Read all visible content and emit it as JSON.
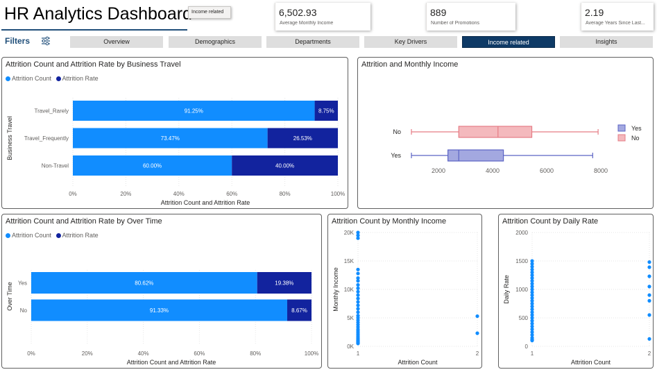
{
  "header": {
    "title": "HR Analytics Dashboard",
    "tooltip_tag": "Income related",
    "filters_label": "Filters",
    "kpis": [
      {
        "value": "6,502.93",
        "label": "Average Monthly Income"
      },
      {
        "value": "889",
        "label": "Number of Promotions"
      },
      {
        "value": "2.19",
        "label": "Average Years Since Last..."
      }
    ]
  },
  "tabs": [
    "Overview",
    "Demographics",
    "Departments",
    "Key Drivers",
    "Income related",
    "Insights"
  ],
  "active_tab": "Income related",
  "colors": {
    "count": "#118dff",
    "rate": "#12239e",
    "yes_box": "#5b63c4",
    "no_box": "#e57c85",
    "accent": "#1f4e79"
  },
  "legend_labels": {
    "count": "Attrition Count",
    "rate": "Attrition Rate"
  },
  "chart_data": [
    {
      "type": "bar",
      "stacked_percent": true,
      "orientation": "horizontal",
      "title": "Attrition Count and Attrition Rate by Business Travel",
      "ylabel": "Business Travel",
      "xlabel": "Attrition Count and Attrition Rate",
      "categories": [
        "Travel_Rarely",
        "Travel_Frequently",
        "Non-Travel"
      ],
      "series": [
        {
          "name": "Attrition Count",
          "values": [
            91.25,
            73.47,
            60.0
          ],
          "labels": [
            "91.25%",
            "73.47%",
            "60.00%"
          ]
        },
        {
          "name": "Attrition Rate",
          "values": [
            8.75,
            26.53,
            40.0
          ],
          "labels": [
            "8.75%",
            "26.53%",
            "40.00%"
          ]
        }
      ],
      "xticks": [
        "0%",
        "20%",
        "40%",
        "60%",
        "80%",
        "100%"
      ],
      "xlim": [
        0,
        100
      ],
      "legend": "top-left"
    },
    {
      "type": "box",
      "title": "Attrition and Monthly Income",
      "categories": [
        "No",
        "Yes"
      ],
      "series": [
        {
          "name": "No",
          "min": 1000,
          "q1": 2750,
          "median": 4200,
          "q3": 5450,
          "max": 7900
        },
        {
          "name": "Yes",
          "min": 1000,
          "q1": 2350,
          "median": 2750,
          "q3": 4400,
          "max": 7700
        }
      ],
      "xticks": [
        "2000",
        "4000",
        "6000",
        "8000"
      ],
      "xlim": [
        1000,
        9000
      ],
      "legend_items": [
        "Yes",
        "No"
      ],
      "legend": "right"
    },
    {
      "type": "bar",
      "stacked_percent": true,
      "orientation": "horizontal",
      "title": "Attrition Count and Attrition Rate by Over Time",
      "ylabel": "Over Time",
      "xlabel": "Attrition Count and Attrition Rate",
      "categories": [
        "Yes",
        "No"
      ],
      "series": [
        {
          "name": "Attrition Count",
          "values": [
            80.62,
            91.33
          ],
          "labels": [
            "80.62%",
            "91.33%"
          ]
        },
        {
          "name": "Attrition Rate",
          "values": [
            19.38,
            8.67
          ],
          "labels": [
            "19.38%",
            "8.67%"
          ]
        }
      ],
      "xticks": [
        "0%",
        "20%",
        "40%",
        "60%",
        "80%",
        "100%"
      ],
      "xlim": [
        0,
        100
      ],
      "legend": "top-left"
    },
    {
      "type": "scatter",
      "title": "Attrition Count by Monthly Income",
      "xlabel": "Attrition Count",
      "ylabel": "Monthly Income",
      "x": [
        1,
        1,
        1,
        1,
        1,
        1,
        1,
        1,
        1,
        1,
        1,
        1,
        1,
        1,
        1,
        1,
        1,
        1,
        1,
        1,
        1,
        1,
        1,
        1,
        1,
        1,
        1,
        1,
        1,
        1,
        1,
        1,
        1,
        1,
        1,
        1,
        2,
        2
      ],
      "y": [
        19000,
        19500,
        20000,
        13500,
        12800,
        12000,
        11500,
        10800,
        10200,
        9600,
        9000,
        8400,
        7800,
        7200,
        6600,
        6000,
        5400,
        5000,
        4600,
        4200,
        3800,
        3400,
        3000,
        2700,
        2400,
        2100,
        1800,
        1500,
        1300,
        1100,
        1000,
        900,
        800,
        700,
        600,
        500,
        5300,
        2300
      ],
      "yticks": [
        "0K",
        "5K",
        "10K",
        "15K",
        "20K"
      ],
      "xticks": [
        "1",
        "2"
      ],
      "ylim": [
        0,
        20000
      ],
      "xlim": [
        1,
        2
      ]
    },
    {
      "type": "scatter",
      "title": "Attrition Count by Daily Rate",
      "xlabel": "Attrition Count",
      "ylabel": "Daily Rate",
      "x": [
        1,
        1,
        1,
        1,
        1,
        1,
        1,
        1,
        1,
        1,
        1,
        1,
        1,
        1,
        1,
        1,
        1,
        1,
        1,
        1,
        1,
        1,
        1,
        1,
        1,
        1,
        1,
        1,
        1,
        1,
        1,
        2,
        2,
        2,
        2,
        2,
        2,
        2,
        2
      ],
      "y": [
        1500,
        1450,
        1400,
        1350,
        1300,
        1250,
        1200,
        1150,
        1100,
        1050,
        1000,
        950,
        900,
        850,
        800,
        750,
        700,
        650,
        600,
        550,
        500,
        450,
        400,
        350,
        300,
        250,
        200,
        150,
        120,
        110,
        102,
        1480,
        1390,
        1230,
        1050,
        900,
        800,
        550,
        130
      ],
      "yticks": [
        "0",
        "500",
        "1000",
        "1500",
        "2000"
      ],
      "xticks": [
        "1",
        "2"
      ],
      "ylim": [
        0,
        2000
      ],
      "xlim": [
        1,
        2
      ]
    }
  ]
}
